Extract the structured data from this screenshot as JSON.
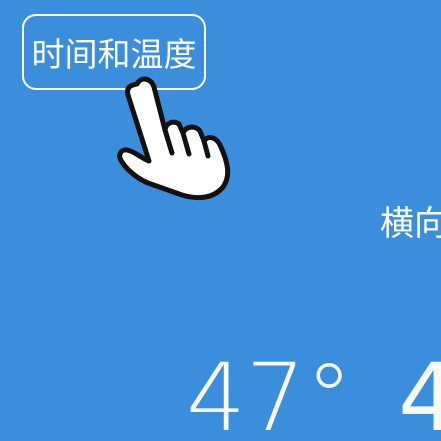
{
  "mode_chip": {
    "label": "时间和温度"
  },
  "side_label": {
    "text": "横向"
  },
  "temperature": {
    "value": "47°",
    "next_value_partial": "4"
  },
  "pointer": {
    "icon": "hand-pointer-icon"
  },
  "colors": {
    "background": "#3b8edc",
    "foreground": "#ffffff",
    "hand_outline": "#111111"
  }
}
